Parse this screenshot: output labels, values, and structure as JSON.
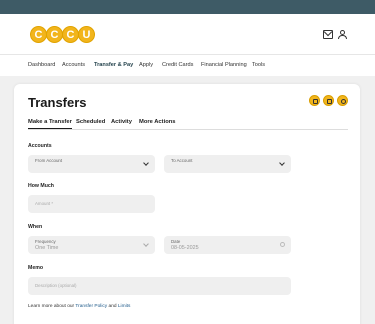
{
  "brand": {
    "logo_letters": [
      "C",
      "C",
      "C",
      "U"
    ],
    "primary_color": "#f2b51c",
    "topbar_color": "#3e5b66"
  },
  "header": {
    "mail_icon": "mail-icon",
    "user_icon": "user-icon"
  },
  "nav": {
    "items": [
      {
        "label": "Dashboard"
      },
      {
        "label": "Accounts"
      },
      {
        "label": "Transfer & Pay",
        "active": true
      },
      {
        "label": "Apply"
      },
      {
        "label": "Credit Cards"
      },
      {
        "label": "Financial Planning"
      },
      {
        "label": "Tools"
      }
    ]
  },
  "page": {
    "title": "Transfers",
    "tabs": [
      {
        "label": "Make a Transfer",
        "active": true
      },
      {
        "label": "Scheduled"
      },
      {
        "label": "Activity"
      },
      {
        "label": "More Actions"
      }
    ]
  },
  "form": {
    "accounts_heading": "Accounts",
    "from_label": "From Account",
    "to_label": "To Account",
    "how_much_heading": "How Much",
    "amount_placeholder": "Amount *",
    "when_heading": "When",
    "frequency_label": "Frequency",
    "frequency_value": "One Time",
    "date_label": "Date",
    "date_value": "08-05-2025",
    "memo_heading": "Memo",
    "memo_placeholder": "Description (optional)"
  },
  "footer": {
    "prefix": "Learn more about our ",
    "policy_link": "Transfer Policy",
    "and": " and ",
    "limits_link": "Limits"
  }
}
